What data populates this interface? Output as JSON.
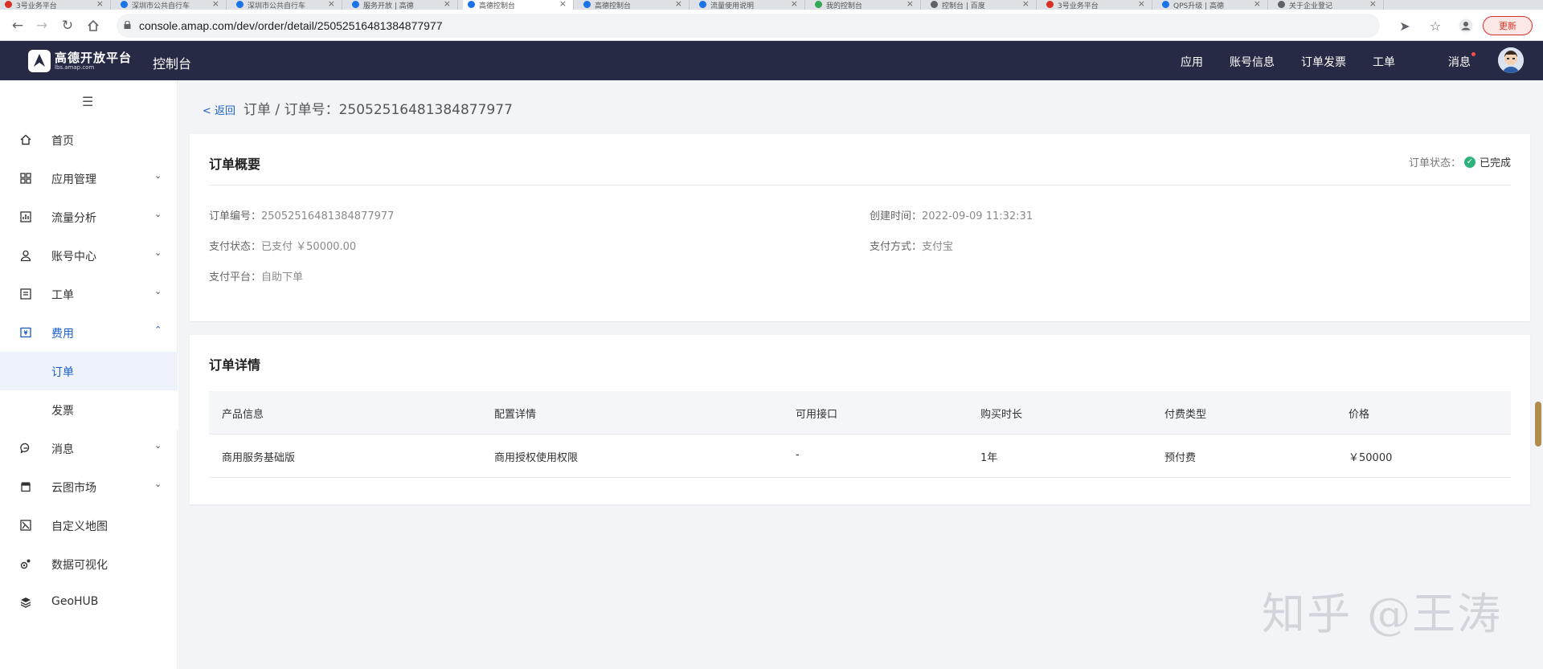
{
  "browser": {
    "tabs": [
      {
        "label": "3号业务平台",
        "color": "#d93025"
      },
      {
        "label": "深圳市公共自行车",
        "color": "#1a73e8"
      },
      {
        "label": "深圳市公共自行车",
        "color": "#1a73e8"
      },
      {
        "label": "服务开放 | 高德",
        "color": "#1a73e8"
      },
      {
        "label": "高德控制台",
        "color": "#1a73e8"
      },
      {
        "label": "高德控制台",
        "color": "#1a73e8"
      },
      {
        "label": "流量使用说明",
        "color": "#1a73e8"
      },
      {
        "label": "我的控制台",
        "color": "#34a853"
      },
      {
        "label": "控制台 | 百度",
        "color": "#5f6368"
      },
      {
        "label": "3号业务平台",
        "color": "#d93025"
      },
      {
        "label": "QPS升级 | 高德",
        "color": "#1a73e8"
      },
      {
        "label": "关于企业登记",
        "color": "#5f6368"
      }
    ],
    "url": "console.amap.com/dev/order/detail/25052516481384877977",
    "update_label": "更新"
  },
  "header": {
    "logo_text": "高德开放平台",
    "logo_sub": "lbs.amap.com",
    "console_label": "控制台",
    "nav": [
      "应用",
      "账号信息",
      "订单发票",
      "工单",
      "消息"
    ]
  },
  "sidebar": {
    "items": [
      {
        "label": "首页",
        "icon": "home-icon"
      },
      {
        "label": "应用管理",
        "icon": "apps-icon"
      },
      {
        "label": "流量分析",
        "icon": "chart-icon"
      },
      {
        "label": "账号中心",
        "icon": "user-icon"
      },
      {
        "label": "工单",
        "icon": "ticket-icon"
      },
      {
        "label": "费用",
        "icon": "money-icon"
      },
      {
        "label": "订单",
        "icon": ""
      },
      {
        "label": "发票",
        "icon": ""
      },
      {
        "label": "消息",
        "icon": "message-icon"
      },
      {
        "label": "云图市场",
        "icon": "store-icon"
      },
      {
        "label": "自定义地图",
        "icon": "map-icon"
      },
      {
        "label": "数据可视化",
        "icon": "visual-icon"
      },
      {
        "label": "GeoHUB",
        "icon": "layers-icon"
      }
    ]
  },
  "page": {
    "back_label": "< 返回",
    "title": "订单 / 订单号：25052516481384877977"
  },
  "summary": {
    "title": "订单概要",
    "status_label": "订单状态：",
    "status_value": "已完成",
    "order_no_label": "订单编号：",
    "order_no_value": "25052516481384877977",
    "created_label": "创建时间：",
    "created_value": "2022-09-09 11:32:31",
    "pay_status_label": "支付状态：",
    "pay_status_value": "已支付 ￥50000.00",
    "pay_method_label": "支付方式：",
    "pay_method_value": "支付宝",
    "platform_label": "支付平台：",
    "platform_value": "自助下单"
  },
  "details": {
    "title": "订单详情",
    "columns": [
      "产品信息",
      "配置详情",
      "可用接口",
      "购买时长",
      "付费类型",
      "价格"
    ],
    "rows": [
      [
        "商用服务基础版",
        "商用授权使用权限",
        "-",
        "1年",
        "预付费",
        "￥50000"
      ]
    ]
  },
  "watermark": "知乎 @王涛",
  "colors": {
    "header_bg": "#262a45",
    "accent": "#1b5fc4",
    "success": "#2fb37c"
  }
}
